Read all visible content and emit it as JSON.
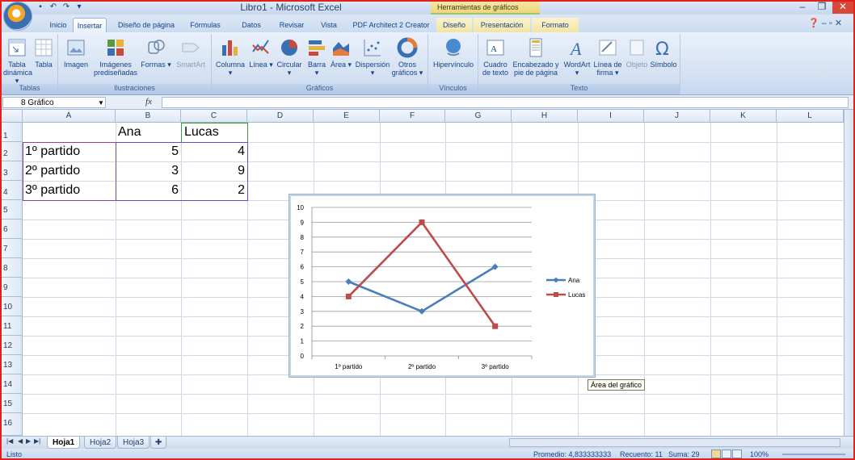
{
  "window": {
    "title": "Libro1 - Microsoft Excel",
    "context_title": "Herramientas de gráficos"
  },
  "qat": {
    "save_glyph": "▪",
    "undo_glyph": "↶",
    "redo_glyph": "↷",
    "more_glyph": "▾"
  },
  "tabs": [
    {
      "label": "Inicio"
    },
    {
      "label": "Insertar"
    },
    {
      "label": "Diseño de página"
    },
    {
      "label": "Fórmulas"
    },
    {
      "label": "Datos"
    },
    {
      "label": "Revisar"
    },
    {
      "label": "Vista"
    },
    {
      "label": "PDF Architect 2 Creator"
    },
    {
      "label": "Diseño"
    },
    {
      "label": "Presentación"
    },
    {
      "label": "Formato"
    }
  ],
  "ribbon": {
    "groups": [
      {
        "label": "Tablas"
      },
      {
        "label": "Ilustraciones"
      },
      {
        "label": "Gráficos"
      },
      {
        "label": "Vínculos"
      },
      {
        "label": "Texto"
      }
    ],
    "buttons": {
      "tabla_dinamica": "Tabla dinámica ▾",
      "tabla": "Tabla",
      "imagen": "Imagen",
      "imagenes_prediseñadas": "Imágenes prediseñadas",
      "formas": "Formas ▾",
      "smartart": "SmartArt",
      "columna": "Columna ▾",
      "linea": "Línea ▾",
      "circular": "Circular ▾",
      "barra": "Barra ▾",
      "area": "Área ▾",
      "dispersion": "Dispersión ▾",
      "otros_graficos": "Otros gráficos ▾",
      "hipervinculo": "Hipervínculo",
      "cuadro_texto": "Cuadro de texto",
      "encabezado": "Encabezado y pie de página",
      "wordart": "WordArt ▾",
      "linea_firma": "Línea de firma ▾",
      "objeto": "Objeto",
      "simbolo": "Símbolo"
    }
  },
  "formula_bar": {
    "name_box": "8 Gráfico",
    "fx": "fx",
    "formula": ""
  },
  "columns": [
    "A",
    "B",
    "C",
    "D",
    "E",
    "F",
    "G",
    "H",
    "I",
    "J",
    "K",
    "L"
  ],
  "rows": [
    "1",
    "2",
    "3",
    "4",
    "5",
    "6",
    "7",
    "8",
    "9",
    "10",
    "11",
    "12",
    "13",
    "14",
    "15",
    "16"
  ],
  "sheet": {
    "B1": "Ana",
    "C1": "Lucas",
    "A2": "1º partido",
    "B2": "5",
    "C2": "4",
    "A3": "2º partido",
    "B3": "3",
    "C3": "9",
    "A4": "3º partido",
    "B4": "6",
    "C4": "2"
  },
  "chart_data": {
    "type": "line",
    "categories": [
      "1º partido",
      "2º partido",
      "3º partido"
    ],
    "series": [
      {
        "name": "Ana",
        "values": [
          5,
          3,
          6
        ],
        "color": "#4a7ebb"
      },
      {
        "name": "Lucas",
        "values": [
          4,
          9,
          2
        ],
        "color": "#be4b48"
      }
    ],
    "ylim": [
      0,
      10
    ],
    "yticks": [
      0,
      1,
      2,
      3,
      4,
      5,
      6,
      7,
      8,
      9,
      10
    ],
    "grid": true,
    "legend": "right",
    "title": "",
    "xlabel": "",
    "ylabel": ""
  },
  "tooltip": "Área del gráfico",
  "sheet_tabs": [
    {
      "label": "Hoja1"
    },
    {
      "label": "Hoja2"
    },
    {
      "label": "Hoja3"
    }
  ],
  "status": {
    "ready": "Listo",
    "average": "Promedio: 4,833333333",
    "count": "Recuento: 11",
    "sum": "Suma: 29",
    "zoom": "100%"
  }
}
